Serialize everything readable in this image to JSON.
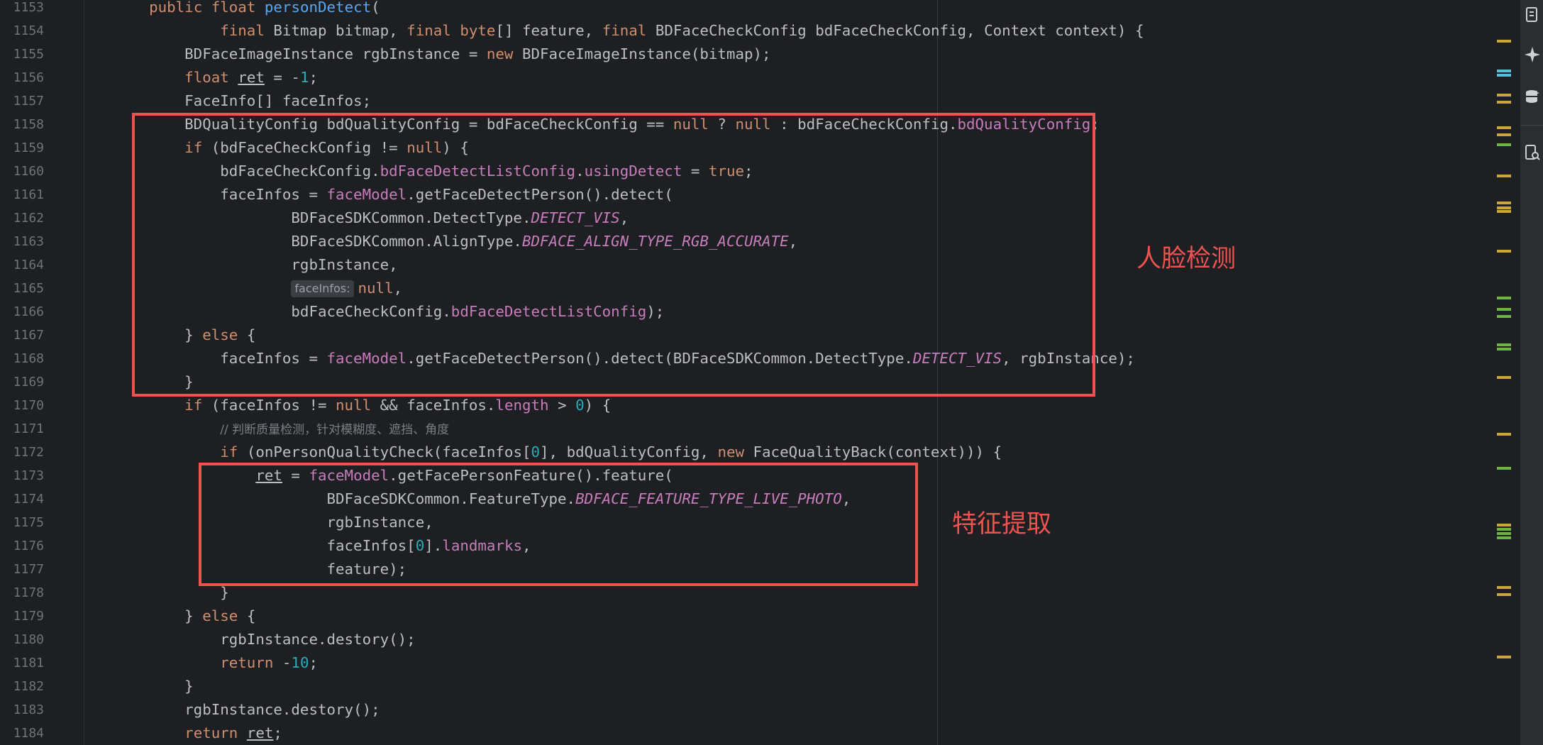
{
  "editor": {
    "lines": [
      {
        "n": "1153",
        "t": [
          {
            "s": "    "
          },
          {
            "s": "public",
            "c": "kw"
          },
          {
            "s": " "
          },
          {
            "s": "float",
            "c": "kw"
          },
          {
            "s": " "
          },
          {
            "s": "personDetect",
            "c": "fn"
          },
          {
            "s": "("
          }
        ]
      },
      {
        "n": "1154",
        "t": [
          {
            "s": "            "
          },
          {
            "s": "final",
            "c": "kw"
          },
          {
            "s": " Bitmap bitmap, "
          },
          {
            "s": "final",
            "c": "kw"
          },
          {
            "s": " "
          },
          {
            "s": "byte",
            "c": "kw"
          },
          {
            "s": "[] feature, "
          },
          {
            "s": "final",
            "c": "kw"
          },
          {
            "s": " BDFaceCheckConfig bdFaceCheckConfig, Context context) {"
          }
        ]
      },
      {
        "n": "1155",
        "t": [
          {
            "s": "        BDFaceImageInstance rgbInstance = "
          },
          {
            "s": "new",
            "c": "kw"
          },
          {
            "s": " BDFaceImageInstance(bitmap);"
          }
        ]
      },
      {
        "n": "1156",
        "t": [
          {
            "s": "        "
          },
          {
            "s": "float",
            "c": "kw"
          },
          {
            "s": " "
          },
          {
            "s": "ret",
            "c": "ul"
          },
          {
            "s": " = -"
          },
          {
            "s": "1",
            "c": "num"
          },
          {
            "s": ";"
          }
        ]
      },
      {
        "n": "1157",
        "t": [
          {
            "s": "        FaceInfo[] faceInfos;"
          }
        ]
      },
      {
        "n": "1158",
        "t": [
          {
            "s": "        BDQualityConfig bdQualityConfig = bdFaceCheckConfig == "
          },
          {
            "s": "null",
            "c": "kw"
          },
          {
            "s": " ? "
          },
          {
            "s": "null",
            "c": "kw"
          },
          {
            "s": " : bdFaceCheckConfig."
          },
          {
            "s": "bdQualityConfig",
            "c": "fld"
          },
          {
            "s": ";"
          }
        ]
      },
      {
        "n": "1159",
        "t": [
          {
            "s": "        "
          },
          {
            "s": "if",
            "c": "kw"
          },
          {
            "s": " (bdFaceCheckConfig != "
          },
          {
            "s": "null",
            "c": "kw"
          },
          {
            "s": ") {"
          }
        ]
      },
      {
        "n": "1160",
        "t": [
          {
            "s": "            bdFaceCheckConfig."
          },
          {
            "s": "bdFaceDetectListConfig",
            "c": "fld"
          },
          {
            "s": "."
          },
          {
            "s": "usingDetect",
            "c": "fld"
          },
          {
            "s": " = "
          },
          {
            "s": "true",
            "c": "kw"
          },
          {
            "s": ";"
          }
        ]
      },
      {
        "n": "1161",
        "t": [
          {
            "s": "            faceInfos = "
          },
          {
            "s": "faceModel",
            "c": "fld"
          },
          {
            "s": ".getFaceDetectPerson().detect("
          }
        ]
      },
      {
        "n": "1162",
        "t": [
          {
            "s": "                    BDFaceSDKCommon.DetectType."
          },
          {
            "s": "DETECT_VIS",
            "c": "it"
          },
          {
            "s": ","
          }
        ]
      },
      {
        "n": "1163",
        "t": [
          {
            "s": "                    BDFaceSDKCommon.AlignType."
          },
          {
            "s": "BDFACE_ALIGN_TYPE_RGB_ACCURATE",
            "c": "it"
          },
          {
            "s": ","
          }
        ]
      },
      {
        "n": "1164",
        "t": [
          {
            "s": "                    rgbInstance,"
          }
        ]
      },
      {
        "n": "1165",
        "t": [
          {
            "s": "                    "
          },
          {
            "s": "faceInfos:",
            "c": "hint"
          },
          {
            "s": "null",
            "c": "kw"
          },
          {
            "s": ","
          }
        ]
      },
      {
        "n": "1166",
        "t": [
          {
            "s": "                    bdFaceCheckConfig."
          },
          {
            "s": "bdFaceDetectListConfig",
            "c": "fld"
          },
          {
            "s": ");"
          }
        ]
      },
      {
        "n": "1167",
        "t": [
          {
            "s": "        } "
          },
          {
            "s": "else",
            "c": "kw"
          },
          {
            "s": " {"
          }
        ]
      },
      {
        "n": "1168",
        "t": [
          {
            "s": "            faceInfos = "
          },
          {
            "s": "faceModel",
            "c": "fld"
          },
          {
            "s": ".getFaceDetectPerson().detect(BDFaceSDKCommon.DetectType."
          },
          {
            "s": "DETECT_VIS",
            "c": "it"
          },
          {
            "s": ", rgbInstance);"
          }
        ]
      },
      {
        "n": "1169",
        "t": [
          {
            "s": "        }"
          }
        ]
      },
      {
        "n": "1170",
        "t": [
          {
            "s": "        "
          },
          {
            "s": "if",
            "c": "kw"
          },
          {
            "s": " (faceInfos != "
          },
          {
            "s": "null",
            "c": "kw"
          },
          {
            "s": " && faceInfos."
          },
          {
            "s": "length",
            "c": "fld"
          },
          {
            "s": " > "
          },
          {
            "s": "0",
            "c": "num"
          },
          {
            "s": ") {"
          }
        ]
      },
      {
        "n": "1171",
        "t": [
          {
            "s": "            "
          },
          {
            "s": "// 判断质量检测，针对模糊度、遮挡、角度",
            "c": "cm"
          }
        ]
      },
      {
        "n": "1172",
        "t": [
          {
            "s": "            "
          },
          {
            "s": "if",
            "c": "kw"
          },
          {
            "s": " (onPersonQualityCheck(faceInfos["
          },
          {
            "s": "0",
            "c": "num"
          },
          {
            "s": "], bdQualityConfig, "
          },
          {
            "s": "new",
            "c": "kw"
          },
          {
            "s": " FaceQualityBack(context))) {"
          }
        ]
      },
      {
        "n": "1173",
        "t": [
          {
            "s": "                "
          },
          {
            "s": "ret",
            "c": "ul"
          },
          {
            "s": " = "
          },
          {
            "s": "faceModel",
            "c": "fld"
          },
          {
            "s": ".getFacePersonFeature().feature("
          }
        ]
      },
      {
        "n": "1174",
        "t": [
          {
            "s": "                        BDFaceSDKCommon.FeatureType."
          },
          {
            "s": "BDFACE_FEATURE_TYPE_LIVE_PHOTO",
            "c": "it"
          },
          {
            "s": ","
          }
        ]
      },
      {
        "n": "1175",
        "t": [
          {
            "s": "                        rgbInstance,"
          }
        ]
      },
      {
        "n": "1176",
        "t": [
          {
            "s": "                        faceInfos["
          },
          {
            "s": "0",
            "c": "num"
          },
          {
            "s": "]."
          },
          {
            "s": "landmarks",
            "c": "fld"
          },
          {
            "s": ","
          }
        ]
      },
      {
        "n": "1177",
        "t": [
          {
            "s": "                        feature);"
          }
        ]
      },
      {
        "n": "1178",
        "t": [
          {
            "s": "            }"
          }
        ]
      },
      {
        "n": "1179",
        "t": [
          {
            "s": "        } "
          },
          {
            "s": "else",
            "c": "kw"
          },
          {
            "s": " {"
          }
        ]
      },
      {
        "n": "1180",
        "t": [
          {
            "s": "            rgbInstance.destory();"
          }
        ]
      },
      {
        "n": "1181",
        "t": [
          {
            "s": "            "
          },
          {
            "s": "return",
            "c": "kw"
          },
          {
            "s": " -"
          },
          {
            "s": "10",
            "c": "num"
          },
          {
            "s": ";"
          }
        ]
      },
      {
        "n": "1182",
        "t": [
          {
            "s": "        }"
          }
        ]
      },
      {
        "n": "1183",
        "t": [
          {
            "s": "        rgbInstance.destory();"
          }
        ]
      },
      {
        "n": "1184",
        "t": [
          {
            "s": "        "
          },
          {
            "s": "return",
            "c": "kw"
          },
          {
            "s": " "
          },
          {
            "s": "ret",
            "c": "ul"
          },
          {
            "s": ";"
          }
        ]
      }
    ]
  },
  "annotations": {
    "face_detection_label": "人脸检测",
    "feature_extraction_label": "特征提取",
    "color": "#ef5350"
  },
  "scrollbar_markers": [
    {
      "line": 1,
      "color": "#c9a53a"
    }
  ],
  "toolbar": {
    "icons": [
      "document-icon",
      "sparkle-icon",
      "database-icon",
      "search-document-icon"
    ]
  },
  "theme": {
    "background": "#1e1f22",
    "keyword": "#cf8e6d",
    "function": "#56a8f5",
    "number": "#2aacb8",
    "field": "#c77dbb",
    "text": "#bcbec4"
  }
}
